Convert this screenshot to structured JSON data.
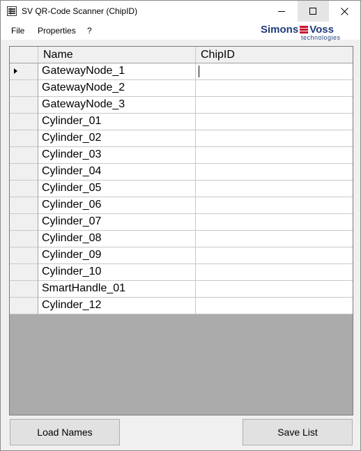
{
  "window": {
    "title": "SV QR-Code Scanner (ChipID)",
    "controls": [
      "minimize",
      "maximize",
      "close"
    ]
  },
  "menu": {
    "file": "File",
    "properties": "Properties",
    "help": "?"
  },
  "logo": {
    "main_left": "Simons",
    "main_right": "Voss",
    "sub": "technologies"
  },
  "grid": {
    "columns": [
      "Name",
      "ChipID"
    ],
    "current_row": 0,
    "rows": [
      {
        "name": "GatewayNode_1",
        "chip_id": ""
      },
      {
        "name": "GatewayNode_2",
        "chip_id": ""
      },
      {
        "name": "GatewayNode_3",
        "chip_id": ""
      },
      {
        "name": "Cylinder_01",
        "chip_id": ""
      },
      {
        "name": "Cylinder_02",
        "chip_id": ""
      },
      {
        "name": "Cylinder_03",
        "chip_id": ""
      },
      {
        "name": "Cylinder_04",
        "chip_id": ""
      },
      {
        "name": "Cylinder_05",
        "chip_id": ""
      },
      {
        "name": "Cylinder_06",
        "chip_id": ""
      },
      {
        "name": "Cylinder_07",
        "chip_id": ""
      },
      {
        "name": "Cylinder_08",
        "chip_id": ""
      },
      {
        "name": "Cylinder_09",
        "chip_id": ""
      },
      {
        "name": "Cylinder_10",
        "chip_id": ""
      },
      {
        "name": "SmartHandle_01",
        "chip_id": ""
      },
      {
        "name": "Cylinder_12",
        "chip_id": ""
      }
    ]
  },
  "buttons": {
    "load": "Load Names",
    "save": "Save List"
  },
  "colors": {
    "logo_blue": "#1e3a78",
    "logo_red": "#c8102e",
    "grid_empty": "#ababab"
  }
}
